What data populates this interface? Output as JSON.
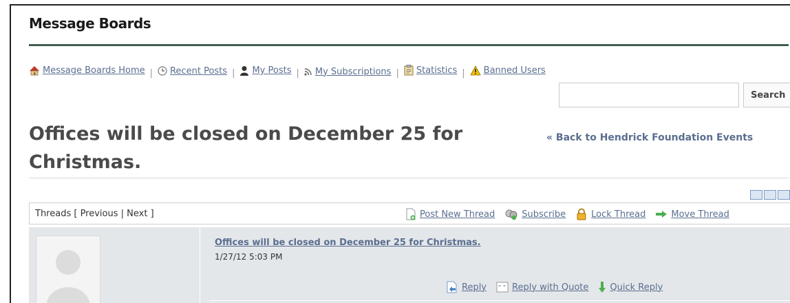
{
  "portlet": {
    "title": "Message Boards"
  },
  "nav": {
    "items": [
      {
        "label": "Message Boards Home",
        "icon": "home-icon"
      },
      {
        "label": "Recent Posts",
        "icon": "clock-icon"
      },
      {
        "label": "My Posts",
        "icon": "user-icon"
      },
      {
        "label": "My Subscriptions",
        "icon": "rss-icon"
      },
      {
        "label": "Statistics",
        "icon": "clipboard-icon"
      },
      {
        "label": "Banned Users",
        "icon": "warning-icon"
      }
    ]
  },
  "search": {
    "value": "",
    "button_label": "Search"
  },
  "thread": {
    "title": "Offices will be closed on December 25 for Christmas.",
    "back_link": "« Back to Hendrick Foundation Events"
  },
  "thread_bar": {
    "nav_text": "Threads [ Previous | Next ]",
    "actions": [
      {
        "label": "Post New Thread",
        "icon": "new-document-icon"
      },
      {
        "label": "Subscribe",
        "icon": "subscribe-icon"
      },
      {
        "label": "Lock Thread",
        "icon": "lock-icon"
      },
      {
        "label": "Move Thread",
        "icon": "arrow-right-icon"
      }
    ]
  },
  "post": {
    "subject": "Offices will be closed on December 25 for Christmas.",
    "date": "1/27/12 5:03 PM",
    "actions": [
      {
        "label": "Reply",
        "icon": "reply-icon"
      },
      {
        "label": "Reply with Quote",
        "icon": "quote-icon"
      },
      {
        "label": "Quick Reply",
        "icon": "arrow-down-icon"
      }
    ]
  },
  "colors": {
    "link": "#5a6e8f",
    "title_rule": "#3f5f4f",
    "post_background": "#e4e7ea"
  }
}
